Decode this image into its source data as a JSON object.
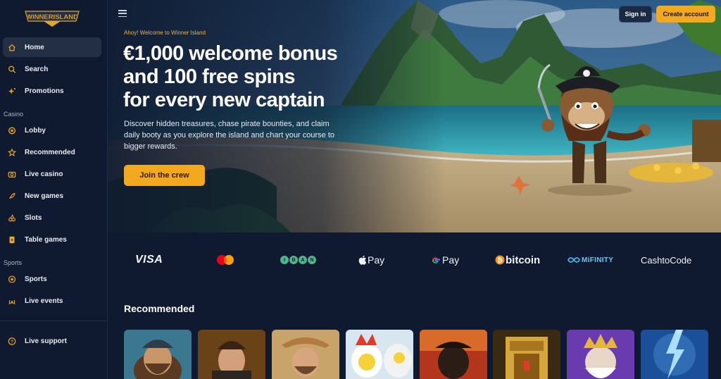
{
  "brand": {
    "logo_text": "WINNERISLAND"
  },
  "sidebar": {
    "items": [
      {
        "label": "Home"
      },
      {
        "label": "Search"
      },
      {
        "label": "Promotions"
      }
    ],
    "casino_section": "Casino",
    "casino_items": [
      {
        "label": "Lobby"
      },
      {
        "label": "Recommended"
      },
      {
        "label": "Live casino"
      },
      {
        "label": "New games"
      },
      {
        "label": "Slots"
      },
      {
        "label": "Table games"
      }
    ],
    "sports_section": "Sports",
    "sports_items": [
      {
        "label": "Sports"
      },
      {
        "label": "Live events"
      }
    ],
    "support_label": "Live support"
  },
  "header": {
    "signin_label": "Sign in",
    "create_label": "Create account"
  },
  "hero": {
    "eyebrow": "Ahoy! Welcome to Winner Island",
    "headline_line1": "€1,000 welcome bonus",
    "headline_line2": "and 100 free spins",
    "headline_line3": "for every new captain",
    "subtext": "Discover hidden treasures, chase pirate bounties, and claim daily booty as you explore the island and chart your course to bigger rewards.",
    "cta_label": "Join the crew"
  },
  "payments": {
    "visa": "VISA",
    "iban": [
      "I",
      "B",
      "A",
      "N"
    ],
    "apple_pay": "Pay",
    "google_pay": "Pay",
    "bitcoin": "bitcoin",
    "mifinity": "MiFINITY",
    "cashtocode": "CashtoCode"
  },
  "recommended": {
    "title": "Recommended"
  },
  "colors": {
    "accent": "#f2a81f",
    "background": "#0f1a30",
    "active_nav": "#232f44"
  }
}
